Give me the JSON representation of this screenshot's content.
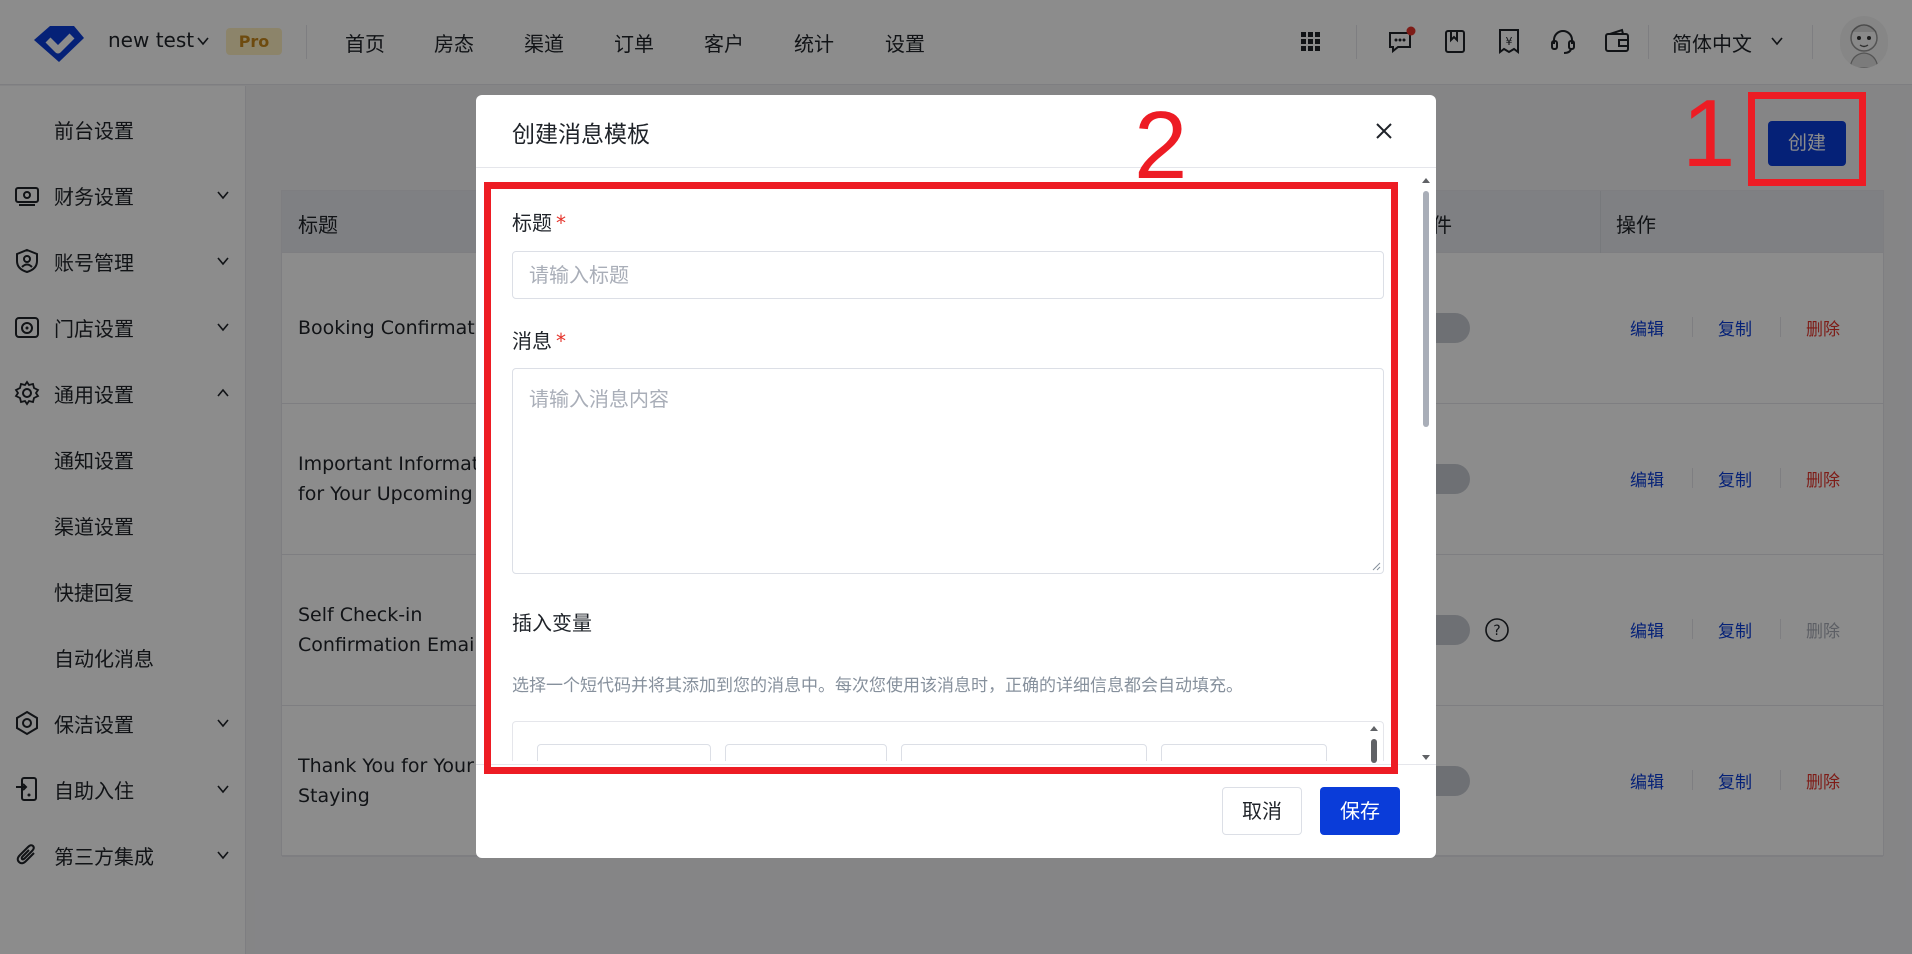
{
  "header": {
    "property_name": "new test",
    "plan_badge": "Pro",
    "nav": [
      "首页",
      "房态",
      "渠道",
      "订单",
      "客户",
      "统计",
      "设置"
    ],
    "language": "简体中文",
    "icons": [
      "apps-grid-icon",
      "message-icon",
      "bookmark-icon",
      "invoice-icon",
      "headset-icon",
      "wallet-icon"
    ]
  },
  "sidebar": {
    "items": [
      {
        "label": "前台设置",
        "icon": "",
        "expandable": false
      },
      {
        "label": "财务设置",
        "icon": "finance-icon",
        "expandable": true
      },
      {
        "label": "账号管理",
        "icon": "shield-user-icon",
        "expandable": true
      },
      {
        "label": "门店设置",
        "icon": "store-icon",
        "expandable": true
      },
      {
        "label": "通用设置",
        "icon": "gear-icon",
        "expandable": true,
        "expanded": true
      },
      {
        "label": "通知设置",
        "icon": "",
        "expandable": false
      },
      {
        "label": "渠道设置",
        "icon": "",
        "expandable": false
      },
      {
        "label": "快捷回复",
        "icon": "",
        "expandable": false
      },
      {
        "label": "自动化消息",
        "icon": "",
        "expandable": false
      },
      {
        "label": "保洁设置",
        "icon": "cleaning-icon",
        "expandable": true
      },
      {
        "label": "自助入住",
        "icon": "self-checkin-icon",
        "expandable": true
      },
      {
        "label": "第三方集成",
        "icon": "paperclip-icon",
        "expandable": true
      }
    ]
  },
  "toolbar": {
    "create_label": "创建"
  },
  "table": {
    "columns": [
      "标题",
      "件",
      "操作"
    ],
    "rows": [
      {
        "title": [
          "Booking Confirmati"
        ],
        "delete_enabled": true,
        "help": false
      },
      {
        "title": [
          "Important Informat",
          "for Your Upcoming"
        ],
        "delete_enabled": true,
        "help": false
      },
      {
        "title": [
          "Self Check-in",
          "Confirmation Email"
        ],
        "delete_enabled": false,
        "help": true
      },
      {
        "title": [
          "Thank You for Your",
          "Staying"
        ],
        "delete_enabled": true,
        "help": false
      }
    ],
    "actions": {
      "edit": "编辑",
      "copy": "复制",
      "delete": "删除"
    }
  },
  "modal": {
    "title": "创建消息模板",
    "title_label": "标题",
    "title_placeholder": "请输入标题",
    "message_label": "消息",
    "message_placeholder": "请输入消息内容",
    "required_mark": "*",
    "insert_var_title": "插入变量",
    "insert_var_hint": "选择一个短代码并将其添加到您的消息中。每次您使用该消息时，正确的详细信息都会自动填充。",
    "cancel_label": "取消",
    "save_label": "保存"
  },
  "annotations": {
    "step1": "1",
    "step2": "2"
  },
  "colors": {
    "primary": "#0a3cd9",
    "danger": "#e5332a",
    "annotation": "#ed1c24",
    "badge_bg": "#fff1c2",
    "badge_text": "#c9891c"
  }
}
